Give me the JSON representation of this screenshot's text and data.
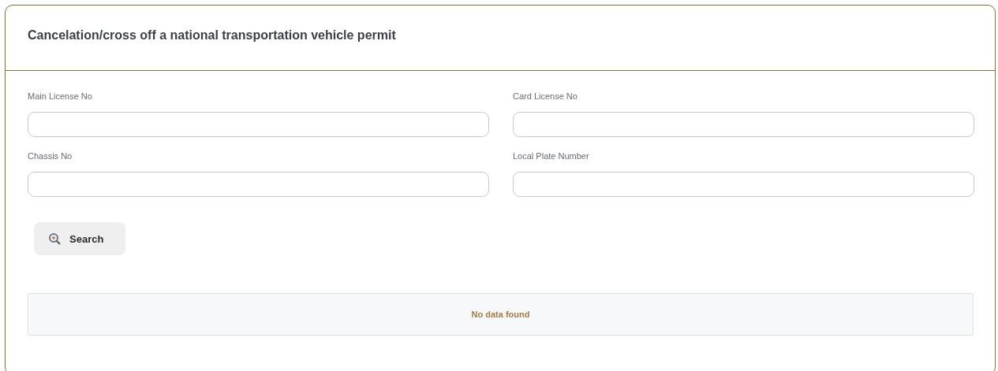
{
  "card": {
    "title": "Cancelation/cross off a national transportation vehicle permit"
  },
  "fields": [
    {
      "label": "Main License No"
    },
    {
      "label": "Card License No"
    },
    {
      "label": "Chassis No"
    },
    {
      "label": "Local Plate Number"
    }
  ],
  "search_button": {
    "label": "Search"
  },
  "results": {
    "empty_message": "No data found"
  }
}
